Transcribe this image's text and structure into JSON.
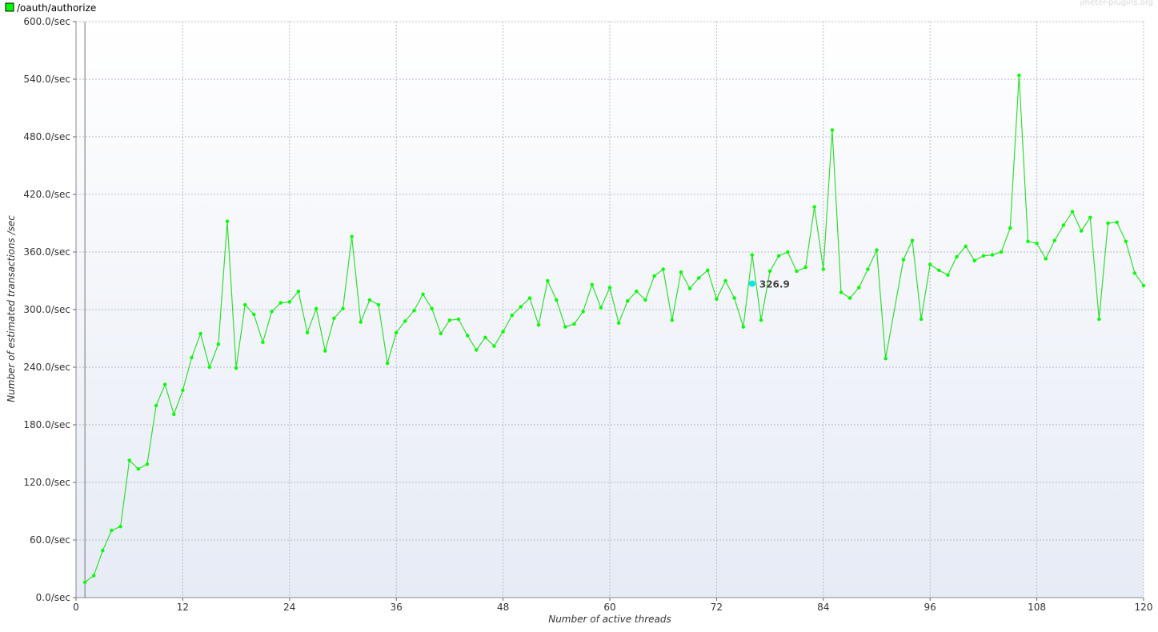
{
  "watermark": "jmeter-plugins.org",
  "colors": {
    "series": "#00ff00",
    "series_line": "#33dd33",
    "hover": "#00e5ee",
    "grid": "#b8bcc4",
    "plot_top": "#ffffff",
    "plot_bottom": "#e6ebf5"
  },
  "chart_data": {
    "type": "line",
    "title": "",
    "xlabel": "Number of active threads",
    "ylabel": "Number of estimated transactions /sec",
    "xlim": [
      0,
      120
    ],
    "ylim": [
      0,
      600
    ],
    "x_ticks": [
      0,
      12,
      24,
      36,
      48,
      60,
      72,
      84,
      96,
      108,
      120
    ],
    "y_ticks": [
      0,
      60,
      120,
      180,
      240,
      300,
      360,
      420,
      480,
      540,
      600
    ],
    "y_tick_labels": [
      "0.0/sec",
      "60.0/sec",
      "120.0/sec",
      "180.0/sec",
      "240.0/sec",
      "300.0/sec",
      "360.0/sec",
      "420.0/sec",
      "480.0/sec",
      "540.0/sec",
      "600.0/sec"
    ],
    "grid": true,
    "legend_position": "top-left",
    "reference_line_x": 1,
    "series": [
      {
        "name": "/oauth/authorize",
        "x": [
          1,
          2,
          3,
          4,
          5,
          6,
          7,
          8,
          9,
          10,
          11,
          12,
          13,
          14,
          15,
          16,
          17,
          18,
          19,
          20,
          21,
          22,
          23,
          24,
          25,
          26,
          27,
          28,
          29,
          30,
          31,
          32,
          33,
          34,
          35,
          36,
          37,
          38,
          39,
          40,
          41,
          42,
          43,
          44,
          45,
          46,
          47,
          48,
          49,
          50,
          51,
          52,
          53,
          54,
          55,
          56,
          57,
          58,
          59,
          60,
          61,
          62,
          63,
          64,
          65,
          66,
          67,
          68,
          69,
          70,
          71,
          72,
          73,
          74,
          75,
          76,
          77,
          78,
          79,
          80,
          81,
          82,
          83,
          84,
          85,
          86,
          87,
          88,
          89,
          90,
          91,
          93,
          94,
          95,
          96,
          97,
          98,
          99,
          100,
          101,
          102,
          103,
          104,
          105,
          106,
          107,
          108,
          109,
          110,
          111,
          112,
          113,
          114,
          115,
          116,
          117,
          118,
          119,
          120
        ],
        "y": [
          16,
          23,
          49,
          70,
          74,
          143,
          134,
          139,
          200,
          222,
          191,
          216,
          250,
          275,
          240,
          264,
          392,
          239,
          305,
          295,
          266,
          298,
          307,
          308,
          319,
          276,
          301,
          257,
          291,
          301,
          376,
          287,
          310,
          305,
          244,
          276,
          288,
          299,
          316,
          301,
          275,
          289,
          290,
          273,
          258,
          271,
          262,
          277,
          294,
          303,
          312,
          284,
          330,
          310,
          282,
          285,
          298,
          326,
          302,
          323,
          286,
          309,
          319,
          310,
          335,
          342,
          289,
          339,
          322,
          333,
          341,
          311,
          330,
          312,
          282,
          357,
          289,
          340,
          356,
          360,
          340,
          344,
          407,
          342,
          487,
          318,
          312,
          323,
          342,
          362,
          249,
          352,
          372,
          290,
          347,
          341,
          336,
          355,
          366,
          351,
          356,
          357,
          360,
          385,
          544,
          371,
          369,
          353,
          372,
          388,
          402,
          382,
          396,
          290,
          390,
          391,
          371,
          338,
          325
        ],
        "color": "#00ff00"
      }
    ],
    "hover_point": {
      "x": 76,
      "y": 327,
      "label": "326.9"
    }
  }
}
